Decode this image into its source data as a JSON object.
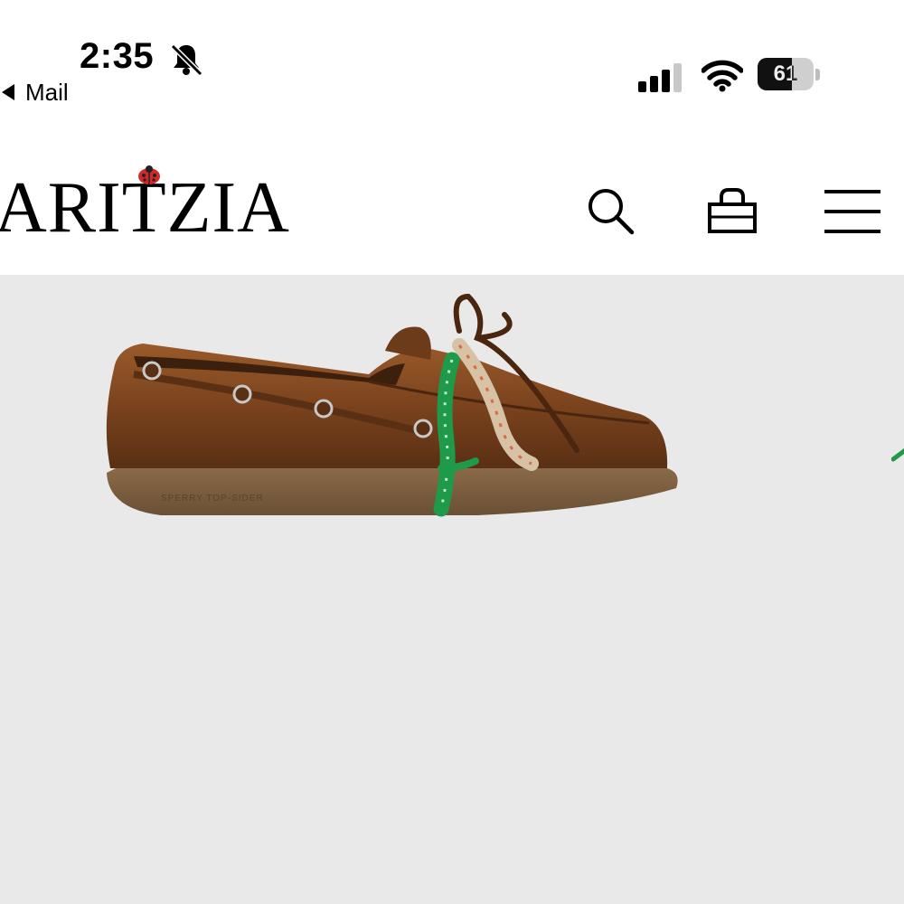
{
  "status_bar": {
    "time": "2:35",
    "silent_icon": "bell-slash-icon",
    "back_app_label": "Mail",
    "back_icon": "back-triangle-icon",
    "signal_icon": "cellular-signal-icon",
    "wifi_icon": "wifi-icon",
    "battery_percent": "61",
    "battery_level": 0.61
  },
  "header": {
    "logo_text": "ARITZIA",
    "logo_icon": "ladybug-icon",
    "search_icon": "search-icon",
    "bag_icon": "shopping-bag-icon",
    "menu_icon": "hamburger-menu-icon"
  },
  "hero": {
    "image_subject": "brown leather boat shoe with green and beige rope laces",
    "sole_text": "SPERRY TOP-SIDER",
    "background_color": "#e9e9ea"
  },
  "colors": {
    "leather": "#6f3d1c",
    "sole": "#7b6040",
    "green_lace": "#1f9a4a",
    "ladybug": "#d12a2a"
  }
}
